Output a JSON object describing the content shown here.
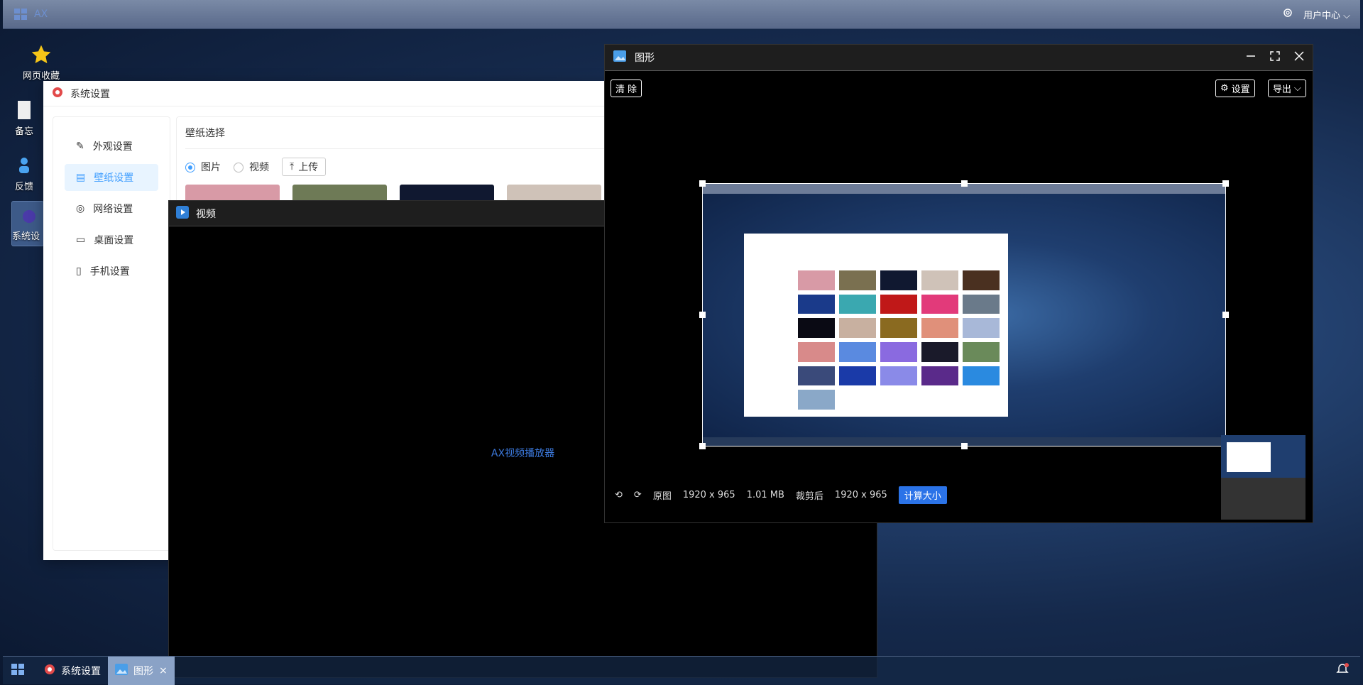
{
  "topbar": {
    "app": "AX",
    "user_center": "用户中心"
  },
  "desktop": {
    "icons": [
      {
        "label": "网页收藏"
      },
      {
        "label": "备忘"
      },
      {
        "label": "反馈"
      },
      {
        "label": "系统设"
      }
    ]
  },
  "settings": {
    "title": "系统设置",
    "menu": [
      "外观设置",
      "壁纸设置",
      "网络设置",
      "桌面设置",
      "手机设置"
    ],
    "active": 1,
    "section": "壁纸选择",
    "radio_image": "图片",
    "radio_video": "视频",
    "upload": "上传"
  },
  "video": {
    "title": "视频",
    "placeholder": "AX视频播放器"
  },
  "image": {
    "title": "图形",
    "clear": "清 除",
    "settings": "设置",
    "export": "导出",
    "original_label": "原图",
    "original_size": "1920 x 965",
    "file_size": "1.01 MB",
    "cropped_label": "裁剪后",
    "cropped_size": "1920 x 965",
    "calc": "计算大小"
  },
  "taskbar": {
    "items": [
      "系统设置",
      "图形"
    ]
  },
  "colors": {
    "accent": "#409eff",
    "calc": "#2b73e8"
  }
}
